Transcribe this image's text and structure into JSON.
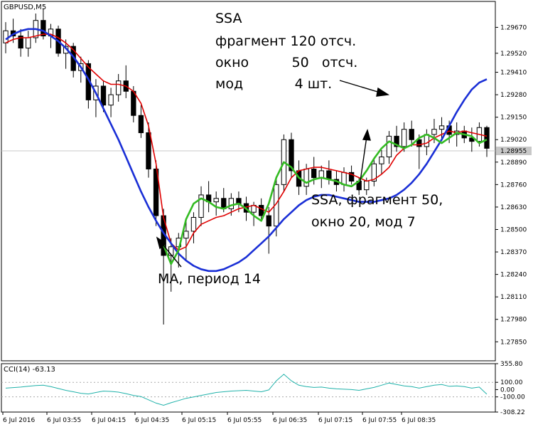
{
  "window": {
    "symbol_label": "GBPUSD,M5"
  },
  "price_panel": {
    "ylim": [
      1.2774,
      1.2982
    ],
    "y_ticks": [
      "1.29670",
      "1.29520",
      "1.29410",
      "1.29280",
      "1.29150",
      "1.29020",
      "1.28890",
      "1.28760",
      "1.28630",
      "1.28500",
      "1.28370",
      "1.28240",
      "1.28110",
      "1.27980",
      "1.27850"
    ],
    "current_price": "1.28955"
  },
  "indicator_panel": {
    "label": "CCI(14) -63.13",
    "y_ticks": [
      "355.80",
      "100.00",
      "0.00",
      "-100.00",
      "-308.22"
    ],
    "ylim": [
      -308.22,
      355.8
    ]
  },
  "x_axis": {
    "labels": [
      "6 Jul 2016",
      "6 Jul 03:55",
      "6 Jul 04:15",
      "6 Jul 04:35",
      "6 Jul 05:15",
      "6 Jul 05:55",
      "6 Jul 06:35",
      "6 Jul 07:15",
      "6 Jul 07:55",
      "6 Jul 08:35"
    ]
  },
  "annotations": {
    "ssa_big": [
      "SSA",
      "фрагмент 120 отсч.",
      "окно          50   отсч.",
      "мод            4 шт."
    ],
    "ssa_small": [
      "SSA, фрагмент 50,",
      "окно 20, мод 7"
    ],
    "ma": "MA, период 14"
  },
  "colors": {
    "up_candle": "#ffffff",
    "down_candle": "#000000",
    "ma_line": "#e00000",
    "ssa_120_line": "#1a2fd6",
    "ssa_50_line": "#33bb22",
    "cci_line": "#20b2aa",
    "grid": "#000000"
  },
  "chart_data": {
    "type": "candlestick",
    "candles": [
      [
        1.2958,
        1.297,
        1.2952,
        1.2965
      ],
      [
        1.2965,
        1.2972,
        1.2958,
        1.2962
      ],
      [
        1.2962,
        1.2966,
        1.295,
        1.2955
      ],
      [
        1.2955,
        1.2965,
        1.295,
        1.2961
      ],
      [
        1.2961,
        1.2975,
        1.2958,
        1.2971
      ],
      [
        1.2971,
        1.2978,
        1.296,
        1.2962
      ],
      [
        1.2962,
        1.2969,
        1.2955,
        1.2966
      ],
      [
        1.2966,
        1.2968,
        1.295,
        1.2952
      ],
      [
        1.2952,
        1.296,
        1.2943,
        1.2956
      ],
      [
        1.2956,
        1.2958,
        1.2938,
        1.2942
      ],
      [
        1.2942,
        1.295,
        1.2935,
        1.2946
      ],
      [
        1.2946,
        1.2948,
        1.292,
        1.2925
      ],
      [
        1.2925,
        1.2937,
        1.2915,
        1.2933
      ],
      [
        1.2933,
        1.2936,
        1.2918,
        1.2922
      ],
      [
        1.2922,
        1.2932,
        1.2915,
        1.2928
      ],
      [
        1.2928,
        1.294,
        1.2924,
        1.2936
      ],
      [
        1.2936,
        1.2945,
        1.2926,
        1.293
      ],
      [
        1.293,
        1.2933,
        1.2912,
        1.2916
      ],
      [
        1.2916,
        1.2922,
        1.2903,
        1.2906
      ],
      [
        1.2906,
        1.2912,
        1.288,
        1.2885
      ],
      [
        1.2885,
        1.289,
        1.2852,
        1.2858
      ],
      [
        1.2858,
        1.2862,
        1.2795,
        1.2835
      ],
      [
        1.2835,
        1.2845,
        1.2814,
        1.284
      ],
      [
        1.284,
        1.2848,
        1.2828,
        1.2845
      ],
      [
        1.2845,
        1.2855,
        1.2832,
        1.2849
      ],
      [
        1.2849,
        1.286,
        1.2842,
        1.2857
      ],
      [
        1.2857,
        1.2875,
        1.2852,
        1.287
      ],
      [
        1.287,
        1.2878,
        1.286,
        1.2866
      ],
      [
        1.2866,
        1.2872,
        1.2858,
        1.2868
      ],
      [
        1.2868,
        1.2874,
        1.286,
        1.2862
      ],
      [
        1.2862,
        1.2871,
        1.2858,
        1.2868
      ],
      [
        1.2868,
        1.2872,
        1.286,
        1.2865
      ],
      [
        1.2865,
        1.2869,
        1.2855,
        1.286
      ],
      [
        1.286,
        1.2866,
        1.2852,
        1.2864
      ],
      [
        1.2864,
        1.2868,
        1.2855,
        1.2858
      ],
      [
        1.2858,
        1.2863,
        1.2836,
        1.2852
      ],
      [
        1.2852,
        1.288,
        1.2846,
        1.2876
      ],
      [
        1.2876,
        1.2905,
        1.2872,
        1.2902
      ],
      [
        1.2902,
        1.2906,
        1.288,
        1.2884
      ],
      [
        1.2884,
        1.289,
        1.287,
        1.2875
      ],
      [
        1.2875,
        1.2888,
        1.287,
        1.2885
      ],
      [
        1.2885,
        1.2892,
        1.2876,
        1.288
      ],
      [
        1.288,
        1.2887,
        1.2874,
        1.2884
      ],
      [
        1.2884,
        1.289,
        1.2876,
        1.2879
      ],
      [
        1.2879,
        1.2884,
        1.2872,
        1.2876
      ],
      [
        1.2876,
        1.2886,
        1.2872,
        1.2883
      ],
      [
        1.2883,
        1.2887,
        1.2876,
        1.2878
      ],
      [
        1.2878,
        1.288,
        1.287,
        1.2873
      ],
      [
        1.2873,
        1.288,
        1.287,
        1.2878
      ],
      [
        1.2878,
        1.2891,
        1.2875,
        1.2888
      ],
      [
        1.2888,
        1.2896,
        1.2882,
        1.2892
      ],
      [
        1.2892,
        1.2907,
        1.2888,
        1.2904
      ],
      [
        1.2904,
        1.291,
        1.2895,
        1.2898
      ],
      [
        1.2898,
        1.2912,
        1.2895,
        1.2908
      ],
      [
        1.2908,
        1.2913,
        1.2898,
        1.2902
      ],
      [
        1.2902,
        1.2905,
        1.2885,
        1.2898
      ],
      [
        1.2898,
        1.2908,
        1.2893,
        1.2905
      ],
      [
        1.2905,
        1.2914,
        1.29,
        1.2908
      ],
      [
        1.2908,
        1.2915,
        1.2902,
        1.291
      ],
      [
        1.291,
        1.2913,
        1.29,
        1.2905
      ],
      [
        1.2905,
        1.2912,
        1.2898,
        1.2907
      ],
      [
        1.2907,
        1.291,
        1.29,
        1.2903
      ],
      [
        1.2903,
        1.2909,
        1.2895,
        1.2901
      ],
      [
        1.2901,
        1.2912,
        1.2898,
        1.2909
      ],
      [
        1.2909,
        1.291,
        1.2892,
        1.2897
      ]
    ],
    "series": [
      {
        "name": "MA, период 14",
        "values": [
          1.2958,
          1.296,
          1.2961,
          1.2961,
          1.2962,
          1.2963,
          1.2963,
          1.2961,
          1.2958,
          1.2954,
          1.2949,
          1.2944,
          1.294,
          1.2936,
          1.2934,
          1.2934,
          1.2933,
          1.293,
          1.2923,
          1.291,
          1.2888,
          1.2857,
          1.2842,
          1.2838,
          1.284,
          1.2848,
          1.2853,
          1.2855,
          1.2857,
          1.2858,
          1.286,
          1.2862,
          1.2863,
          1.2864,
          1.2862,
          1.286,
          1.2865,
          1.2872,
          1.288,
          1.2884,
          1.2885,
          1.2886,
          1.2886,
          1.2885,
          1.2884,
          1.2883,
          1.2882,
          1.288,
          1.2878,
          1.2879,
          1.2882,
          1.2886,
          1.2893,
          1.2897,
          1.2899,
          1.2899,
          1.29,
          1.2903,
          1.2905,
          1.2907,
          1.2906,
          1.2907,
          1.2906,
          1.2905,
          1.2904
        ]
      },
      {
        "name": "SSA, фрагмент 120",
        "values": [
          1.296,
          1.2963,
          1.2965,
          1.2966,
          1.2966,
          1.2965,
          1.2962,
          1.2959,
          1.2955,
          1.295,
          1.2944,
          1.2937,
          1.2929,
          1.292,
          1.2911,
          1.2902,
          1.2892,
          1.2882,
          1.2872,
          1.2863,
          1.2855,
          1.2848,
          1.2842,
          1.2836,
          1.2832,
          1.2829,
          1.2827,
          1.2826,
          1.2826,
          1.2827,
          1.2829,
          1.2831,
          1.2834,
          1.2838,
          1.2842,
          1.2846,
          1.2851,
          1.2856,
          1.286,
          1.2864,
          1.2867,
          1.2869,
          1.287,
          1.287,
          1.2869,
          1.2868,
          1.2867,
          1.2866,
          1.2866,
          1.2866,
          1.2867,
          1.2868,
          1.287,
          1.2873,
          1.2877,
          1.2882,
          1.2888,
          1.2895,
          1.2902,
          1.291,
          1.2918,
          1.2925,
          1.2931,
          1.2935,
          1.2937
        ]
      },
      {
        "name": "SSA, фрагмент 50, окно 20, мод 7",
        "start": 21,
        "values": [
          1.2841,
          1.283,
          1.2838,
          1.2856,
          1.2865,
          1.2868,
          1.2866,
          1.2863,
          1.2862,
          1.2864,
          1.2865,
          1.2862,
          1.2858,
          1.2855,
          1.2865,
          1.288,
          1.2889,
          1.2886,
          1.288,
          1.2877,
          1.2879,
          1.288,
          1.2879,
          1.2878,
          1.2876,
          1.2875,
          1.2878,
          1.2884,
          1.2891,
          1.2897,
          1.2901,
          1.2899,
          1.2897,
          1.2899,
          1.2903,
          1.2905,
          1.2903,
          1.29,
          1.2903,
          1.2906,
          1.2905,
          1.2904,
          1.29,
          1.2902
        ]
      }
    ],
    "cci": [
      20,
      28,
      35,
      45,
      55,
      60,
      40,
      15,
      -10,
      -30,
      -50,
      -60,
      -40,
      -20,
      -25,
      -35,
      -55,
      -80,
      -95,
      -140,
      -185,
      -215,
      -180,
      -150,
      -120,
      -100,
      -80,
      -60,
      -40,
      -30,
      -20,
      -15,
      -10,
      -20,
      -30,
      -5,
      120,
      210,
      120,
      60,
      40,
      30,
      35,
      20,
      10,
      5,
      0,
      -10,
      10,
      30,
      60,
      90,
      70,
      50,
      40,
      20,
      40,
      60,
      70,
      45,
      50,
      40,
      20,
      35,
      -63.13
    ]
  }
}
